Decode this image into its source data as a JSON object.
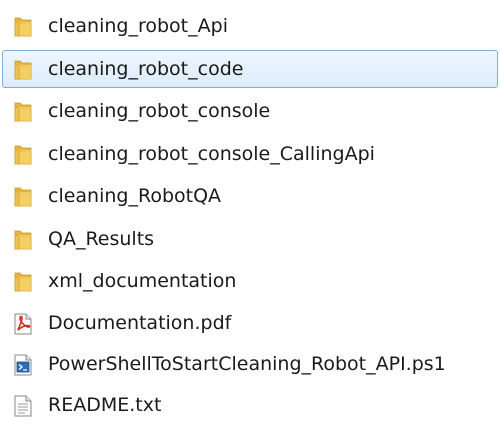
{
  "files": [
    {
      "name": "cleaning_robot_Api",
      "icon": "folder-icon",
      "selected": false
    },
    {
      "name": "cleaning_robot_code",
      "icon": "folder-icon",
      "selected": true
    },
    {
      "name": "cleaning_robot_console",
      "icon": "folder-icon",
      "selected": false
    },
    {
      "name": "cleaning_robot_console_CallingApi",
      "icon": "folder-icon",
      "selected": false
    },
    {
      "name": "cleaning_RobotQA",
      "icon": "folder-icon",
      "selected": false
    },
    {
      "name": "QA_Results",
      "icon": "folder-icon",
      "selected": false
    },
    {
      "name": "xml_documentation",
      "icon": "folder-icon",
      "selected": false
    },
    {
      "name": "Documentation.pdf",
      "icon": "pdf-file-icon",
      "selected": false
    },
    {
      "name": "PowerShellToStartCleaning_Robot_API.ps1",
      "icon": "powershell-script-icon",
      "selected": false
    },
    {
      "name": "README.txt",
      "icon": "text-file-icon",
      "selected": false
    }
  ],
  "colors": {
    "selection_border": "#84acdd",
    "selection_fill": "#dcebfc",
    "folder": "#f3cf64",
    "pdf_red": "#d62a1e"
  }
}
